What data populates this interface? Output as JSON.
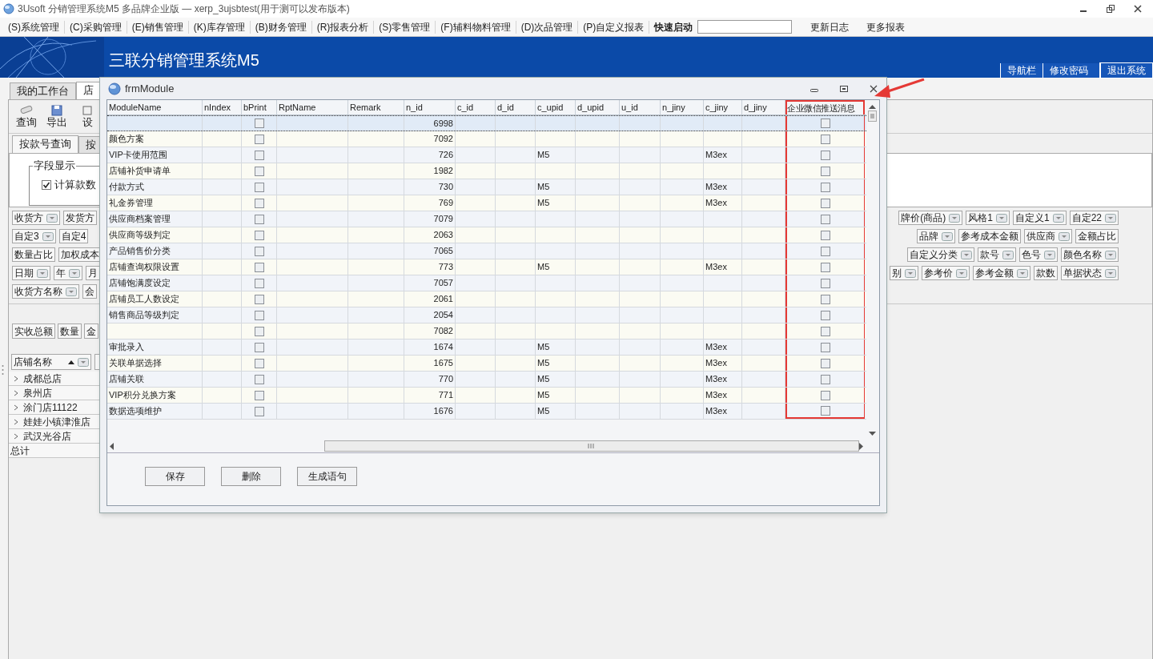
{
  "window": {
    "title": "3Usoft 分销管理系统M5 多品牌企业版 — xerp_3ujsbtest(用于测可以发布版本)"
  },
  "menu": [
    "(S)系统管理",
    "(C)采购管理",
    "(E)销售管理",
    "(K)库存管理",
    "(B)财务管理",
    "(R)报表分析",
    "(S)零售管理",
    "(F)辅料物料管理",
    "(D)次品管理",
    "(P)自定义报表"
  ],
  "quick_launch": {
    "label": "快速启动"
  },
  "menu_extra": [
    "更新日志",
    "更多报表"
  ],
  "banner": {
    "title": "三联分销管理系统M5",
    "links": [
      "导航栏",
      "修改密码",
      "退出系统"
    ]
  },
  "main_tabs": [
    {
      "label": "我的工作台",
      "selected": false
    },
    {
      "label": "店",
      "selected": true
    }
  ],
  "toolbar": [
    {
      "kind": "query",
      "label": "查询"
    },
    {
      "kind": "export",
      "label": "导出"
    },
    {
      "kind": "settings",
      "label": "设"
    }
  ],
  "sub_tabs": [
    {
      "label": "按款号查询",
      "selected": true
    },
    {
      "label": "按",
      "selected": false
    }
  ],
  "field_display": {
    "title": "字段显示",
    "option": {
      "label": "计算款数",
      "checked": true
    }
  },
  "chip_rows": [
    {
      "left": [
        {
          "label": "收货方",
          "dropdown": true
        },
        {
          "label": "发货方",
          "dropdown": false
        }
      ],
      "right": [
        {
          "label": "牌价(商品)",
          "dropdown": true
        },
        {
          "label": "风格1",
          "dropdown": true
        },
        {
          "label": "自定义1",
          "dropdown": true
        },
        {
          "label": "自定22",
          "dropdown": true
        }
      ]
    },
    {
      "left": [
        {
          "label": "自定3",
          "dropdown": true
        },
        {
          "label": "自定4",
          "dropdown": false
        }
      ],
      "right": [
        {
          "label": "品牌",
          "dropdown": true
        },
        {
          "label": "参考成本金额",
          "dropdown": false
        },
        {
          "label": "供应商",
          "dropdown": true
        },
        {
          "label": "金额占比",
          "dropdown": false
        }
      ]
    },
    {
      "left": [
        {
          "label": "数量占比",
          "dropdown": false
        },
        {
          "label": "加权成本",
          "dropdown": false
        }
      ],
      "right": [
        {
          "label": "自定义分类",
          "dropdown": true
        },
        {
          "label": "款号",
          "dropdown": true
        },
        {
          "label": "色号",
          "dropdown": true
        },
        {
          "label": "颜色名称",
          "dropdown": true
        }
      ]
    },
    {
      "left": [
        {
          "label": "日期",
          "dropdown": true
        },
        {
          "label": "年",
          "dropdown": true
        },
        {
          "label": "月",
          "dropdown": false
        }
      ],
      "right": [
        {
          "label": "别",
          "dropdown": true
        },
        {
          "label": "参考价",
          "dropdown": true
        },
        {
          "label": "参考金额",
          "dropdown": true
        },
        {
          "label": "款数",
          "dropdown": false
        },
        {
          "label": "单据状态",
          "dropdown": true
        }
      ]
    },
    {
      "left": [
        {
          "label": "收货方名称",
          "dropdown": true
        },
        {
          "label": "会",
          "dropdown": false
        }
      ],
      "right": []
    }
  ],
  "value_chips": [
    "实收总额",
    "数量",
    "金"
  ],
  "store_grid": {
    "header": {
      "label": "店铺名称"
    },
    "rows": [
      "成都总店",
      "泉州店",
      "涂门店11122",
      "娃娃小镇津淮店",
      "武汉光谷店"
    ],
    "total": "总计"
  },
  "dialog": {
    "title": "frmModule",
    "columns": [
      "ModuleName",
      "nIndex",
      "bPrint",
      "RptName",
      "Remark",
      "n_id",
      "c_id",
      "d_id",
      "c_upid",
      "d_upid",
      "u_id",
      "n_jiny",
      "c_jiny",
      "d_jiny",
      "企业微信推送消息"
    ],
    "rows": [
      {
        "name": "",
        "n_id": "6998",
        "c_upid": "",
        "c_jiny": "",
        "bprint": false,
        "push": false,
        "selected": true
      },
      {
        "name": "颜色方案",
        "n_id": "7092",
        "c_upid": "",
        "c_jiny": "",
        "bprint": false,
        "push": false,
        "selected": false
      },
      {
        "name": "VIP卡使用范围",
        "n_id": "726",
        "c_upid": "M5",
        "c_jiny": "M3ex",
        "bprint": false,
        "push": false,
        "selected": false
      },
      {
        "name": "店铺补货申请单",
        "n_id": "1982",
        "c_upid": "",
        "c_jiny": "",
        "bprint": false,
        "push": false,
        "selected": false
      },
      {
        "name": "付款方式",
        "n_id": "730",
        "c_upid": "M5",
        "c_jiny": "M3ex",
        "bprint": false,
        "push": false,
        "selected": false
      },
      {
        "name": "礼金券管理",
        "n_id": "769",
        "c_upid": "M5",
        "c_jiny": "M3ex",
        "bprint": false,
        "push": false,
        "selected": false
      },
      {
        "name": "供应商档案管理",
        "n_id": "7079",
        "c_upid": "",
        "c_jiny": "",
        "bprint": false,
        "push": false,
        "selected": false
      },
      {
        "name": "供应商等级判定",
        "n_id": "2063",
        "c_upid": "",
        "c_jiny": "",
        "bprint": false,
        "push": false,
        "selected": false
      },
      {
        "name": "产品销售价分类",
        "n_id": "7065",
        "c_upid": "",
        "c_jiny": "",
        "bprint": false,
        "push": false,
        "selected": false
      },
      {
        "name": "店铺查询权限设置",
        "n_id": "773",
        "c_upid": "M5",
        "c_jiny": "M3ex",
        "bprint": false,
        "push": false,
        "selected": false
      },
      {
        "name": "店铺饱满度设定",
        "n_id": "7057",
        "c_upid": "",
        "c_jiny": "",
        "bprint": false,
        "push": false,
        "selected": false
      },
      {
        "name": "店铺员工人数设定",
        "n_id": "2061",
        "c_upid": "",
        "c_jiny": "",
        "bprint": false,
        "push": false,
        "selected": false
      },
      {
        "name": "销售商品等级判定",
        "n_id": "2054",
        "c_upid": "",
        "c_jiny": "",
        "bprint": false,
        "push": false,
        "selected": false
      },
      {
        "name": "",
        "n_id": "7082",
        "c_upid": "",
        "c_jiny": "",
        "bprint": false,
        "push": false,
        "selected": false
      },
      {
        "name": "审批录入",
        "n_id": "1674",
        "c_upid": "M5",
        "c_jiny": "M3ex",
        "bprint": false,
        "push": false,
        "selected": false
      },
      {
        "name": "关联单据选择",
        "n_id": "1675",
        "c_upid": "M5",
        "c_jiny": "M3ex",
        "bprint": false,
        "push": false,
        "selected": false
      },
      {
        "name": "店铺关联",
        "n_id": "770",
        "c_upid": "M5",
        "c_jiny": "M3ex",
        "bprint": false,
        "push": false,
        "selected": false
      },
      {
        "name": "VIP积分兑换方案",
        "n_id": "771",
        "c_upid": "M5",
        "c_jiny": "M3ex",
        "bprint": false,
        "push": false,
        "selected": false
      },
      {
        "name": "数据选项维护",
        "n_id": "1676",
        "c_upid": "M5",
        "c_jiny": "M3ex",
        "bprint": false,
        "push": false,
        "selected": false
      }
    ],
    "buttons": [
      "保存",
      "删除",
      "生成语句"
    ]
  }
}
